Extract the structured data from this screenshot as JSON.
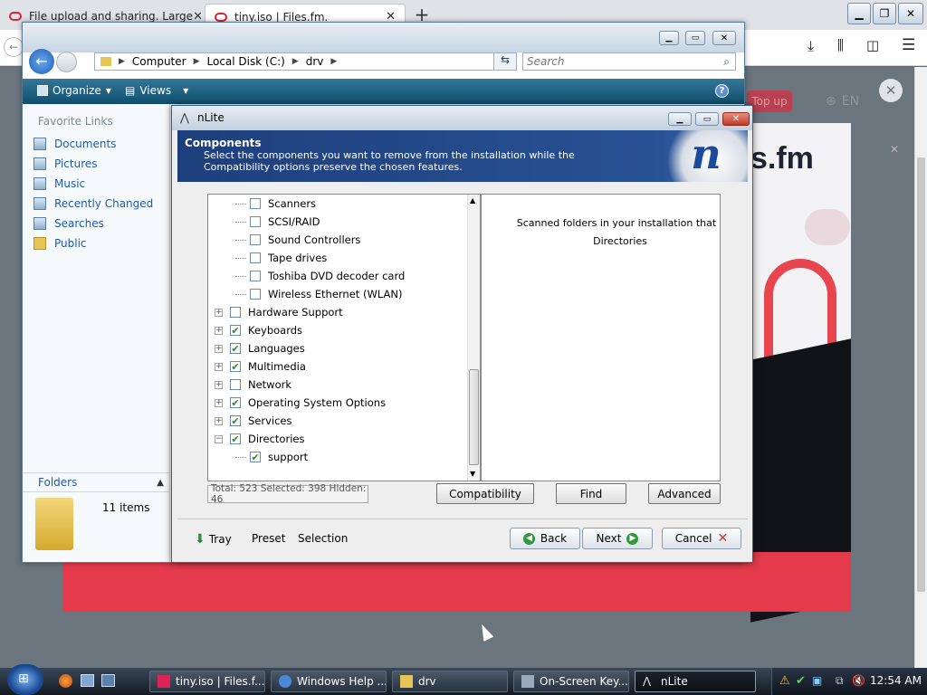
{
  "browser": {
    "tabs": [
      {
        "label": "File upload and sharing. Large"
      },
      {
        "label": "tiny.iso | Files.fm."
      }
    ],
    "new_tab": "+",
    "page": {
      "brand": "s.fm",
      "top_up": "Top up",
      "lang": "EN"
    }
  },
  "explorer": {
    "breadcrumb": [
      "Computer",
      "Local Disk (C:)",
      "drv"
    ],
    "search_placeholder": "Search",
    "toolbar": {
      "organize": "Organize",
      "views": "Views"
    },
    "nav": {
      "heading": "Favorite Links",
      "links": [
        "Documents",
        "Pictures",
        "Music",
        "Recently Changed",
        "Searches",
        "Public"
      ],
      "folders_label": "Folders",
      "item_count": "11 items"
    }
  },
  "nlite": {
    "title": "nLite",
    "header_title": "Components",
    "header_desc": "Select the components you want to remove from the installation while the Compatibility options preserve the chosen features.",
    "tree": [
      {
        "label": "Scanners",
        "checked": false,
        "child": true
      },
      {
        "label": "SCSI/RAID",
        "checked": false,
        "child": true
      },
      {
        "label": "Sound Controllers",
        "checked": false,
        "child": true
      },
      {
        "label": "Tape drives",
        "checked": false,
        "child": true
      },
      {
        "label": "Toshiba DVD decoder card",
        "checked": false,
        "child": true
      },
      {
        "label": "Wireless Ethernet (WLAN)",
        "checked": false,
        "child": true
      },
      {
        "label": "Hardware Support",
        "checked": false,
        "child": false,
        "expander": "+"
      },
      {
        "label": "Keyboards",
        "checked": true,
        "child": false,
        "expander": "+"
      },
      {
        "label": "Languages",
        "checked": true,
        "child": false,
        "expander": "+"
      },
      {
        "label": "Multimedia",
        "checked": true,
        "child": false,
        "expander": "+"
      },
      {
        "label": "Network",
        "checked": false,
        "child": false,
        "expander": "+"
      },
      {
        "label": "Operating System Options",
        "checked": true,
        "child": false,
        "expander": "+"
      },
      {
        "label": "Services",
        "checked": true,
        "child": false,
        "expander": "+"
      },
      {
        "label": "Directories",
        "checked": true,
        "child": false,
        "expander": "−"
      },
      {
        "label": "support",
        "checked": true,
        "child": true
      }
    ],
    "description_line1": "Scanned folders in your installation that",
    "description_line2": "Directories",
    "status": "Total: 523 Selected: 398 Hidden: 46",
    "buttons": {
      "compatibility": "Compatibility",
      "find": "Find",
      "advanced": "Advanced"
    },
    "footer": {
      "tray": "Tray",
      "preset": "Preset",
      "selection": "Selection",
      "back": "Back",
      "next": "Next",
      "cancel": "Cancel"
    }
  },
  "taskbar": {
    "tasks": [
      "tiny.iso | Files.f...",
      "Windows Help ...",
      "drv",
      "On-Screen Key...",
      "nLite"
    ],
    "clock": "12:54 AM"
  }
}
